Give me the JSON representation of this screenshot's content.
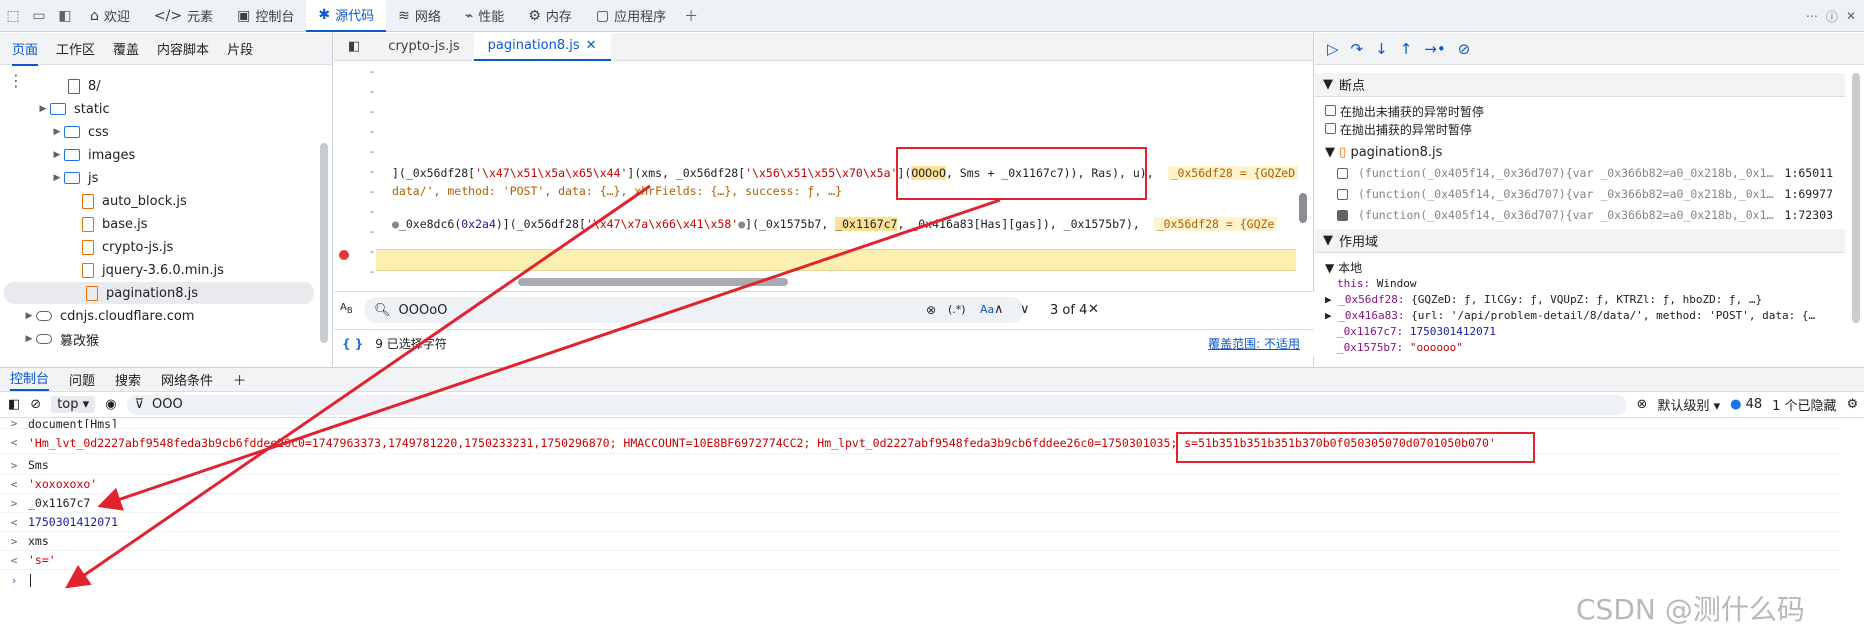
{
  "topbar": {
    "tabs": [
      {
        "icon": "home-icon",
        "label": "欢迎"
      },
      {
        "icon": "code-brackets-icon",
        "label": "元素"
      },
      {
        "icon": "console-icon",
        "label": "控制台"
      },
      {
        "icon": "bug-icon",
        "label": "源代码"
      },
      {
        "icon": "wifi-icon",
        "label": "网络"
      },
      {
        "icon": "performance-icon",
        "label": "性能"
      },
      {
        "icon": "memory-icon",
        "label": "内存"
      },
      {
        "icon": "application-icon",
        "label": "应用程序"
      }
    ],
    "active_tab": "源代码"
  },
  "navigator": {
    "tabs": [
      "页面",
      "工作区",
      "覆盖",
      "内容脚本",
      "片段"
    ],
    "tree": [
      {
        "label": "8/",
        "type": "file-partial"
      },
      {
        "label": "static",
        "type": "folder"
      },
      {
        "label": "css",
        "type": "folder"
      },
      {
        "label": "images",
        "type": "folder"
      },
      {
        "label": "js",
        "type": "folder"
      },
      {
        "label": "auto_block.js",
        "type": "file"
      },
      {
        "label": "base.js",
        "type": "file"
      },
      {
        "label": "crypto-js.js",
        "type": "file"
      },
      {
        "label": "jquery-3.6.0.min.js",
        "type": "file"
      },
      {
        "label": "pagination8.js",
        "type": "file",
        "selected": true
      },
      {
        "label": "cdnjs.cloudflare.com",
        "type": "cloud"
      },
      {
        "label": "篡改猴",
        "type": "cloud"
      }
    ]
  },
  "editor": {
    "tabs": [
      "crypto-js.js",
      "pagination8.js"
    ],
    "line1_pre": "](_0x56df28[",
    "line1_str1": "'\\x47\\x51\\x5a\\x65\\x44'",
    "line1_mid": "](xms, _0x56df28[",
    "line1_str2": "'\\x56\\x51\\x55\\x70\\x5a'",
    "line1_paren": "](",
    "line1_hl": "OOOoO",
    "line1_post": ", Sms + _0x1167c7)), Ras), u),",
    "line1_inline": "_0x56df28 = {GQZeD",
    "line2": "data/', method: 'POST', data: {…}, xhrFields: {…}, success: ƒ, …}",
    "line3_pre": "_0xe8dc6(",
    "line3_num": "0x2a4",
    "line3_mid": ")](_0x56df28[",
    "line3_str": "'\\x47\\x7a\\x66\\x41\\x58'",
    "line3_a": "](_0x1575b7, ",
    "line3_hl": "_0x1167c7",
    "line3_b": ", _0x416a83[Has][gas]), _0x1575b7),",
    "line3_inline": "_0x56df28 = {GQZe",
    "search_value": "OOOoO",
    "search_opts": [
      "(.*)",
      "Aa"
    ],
    "search_count": "3 of 4",
    "status_left": "9 已选择字符",
    "status_right": "覆盖范围: 不适用"
  },
  "debugger": {
    "breakpoints_title": "断点",
    "pause_uncaught": "在抛出未捕获的异常时暂停",
    "pause_caught": "在抛出捕获的异常时暂停",
    "bp_file": "pagination8.js",
    "bp_items": [
      {
        "code": "(function(_0x405f14,_0x36d707){var _0x366b82=a0_0x218b,_0x1…",
        "loc": "1:65011",
        "checked": false
      },
      {
        "code": "(function(_0x405f14,_0x36d707){var _0x366b82=a0_0x218b,_0x1…",
        "loc": "1:69977",
        "checked": false
      },
      {
        "code": "(function(_0x405f14,_0x36d707){var _0x366b82=a0_0x218b,_0x1…",
        "loc": "1:72303",
        "checked": true
      }
    ],
    "scope_title": "作用域",
    "local_title": "本地",
    "scope_this_key": "this:",
    "scope_this_val": "Window",
    "scope_56_key": "_0x56df28:",
    "scope_56_val": "{GQZeD: ƒ, IlCGy: ƒ, VQUpZ: ƒ, KTRZl: ƒ, hboZD: ƒ, …}",
    "scope_41_key": "_0x416a83:",
    "scope_41_val": "{url: '/api/problem-detail/8/data/', method: 'POST', data: {…",
    "scope_11_key": "_0x1167c7:",
    "scope_11_val": "1750301412071",
    "scope_15_key": "_0x1575b7:",
    "scope_15_val": "\"oooooo\""
  },
  "drawer": {
    "tabs": [
      "控制台",
      "问题",
      "搜索",
      "网络条件"
    ],
    "context": "top",
    "filter": "OOO",
    "level": "默认级别",
    "msg_count": "48",
    "hidden_count": "1 个已隐藏",
    "lines": [
      {
        "pfx": ">",
        "text": "document[Hms]",
        "cls": ""
      },
      {
        "pfx": "<",
        "text": "'Hm_lvt_0d2227abf9548feda3b9cb6fddee26c0=1747963373,1749781220,1750233231,1750296870; HMACCOUNT=10E8BF6972774CC2; Hm_lpvt_0d2227abf9548feda3b9cb6fddee26c0=1750301035; s=51b351b351b351b370b0f050305070d0701050b070'",
        "cls": "cstr"
      },
      {
        "pfx": ">",
        "text": "Sms",
        "cls": ""
      },
      {
        "pfx": "<",
        "text": "'xoxoxoxo'",
        "cls": "cstr"
      },
      {
        "pfx": ">",
        "text": "_0x1167c7",
        "cls": ""
      },
      {
        "pfx": "<",
        "text": "1750301412071",
        "cls": "cnum"
      },
      {
        "pfx": ">",
        "text": "xms",
        "cls": ""
      },
      {
        "pfx": "<",
        "text": "'s='",
        "cls": "cstr"
      }
    ]
  },
  "watermark": "CSDN @测什么码",
  "annotation_color": "#e0232e"
}
